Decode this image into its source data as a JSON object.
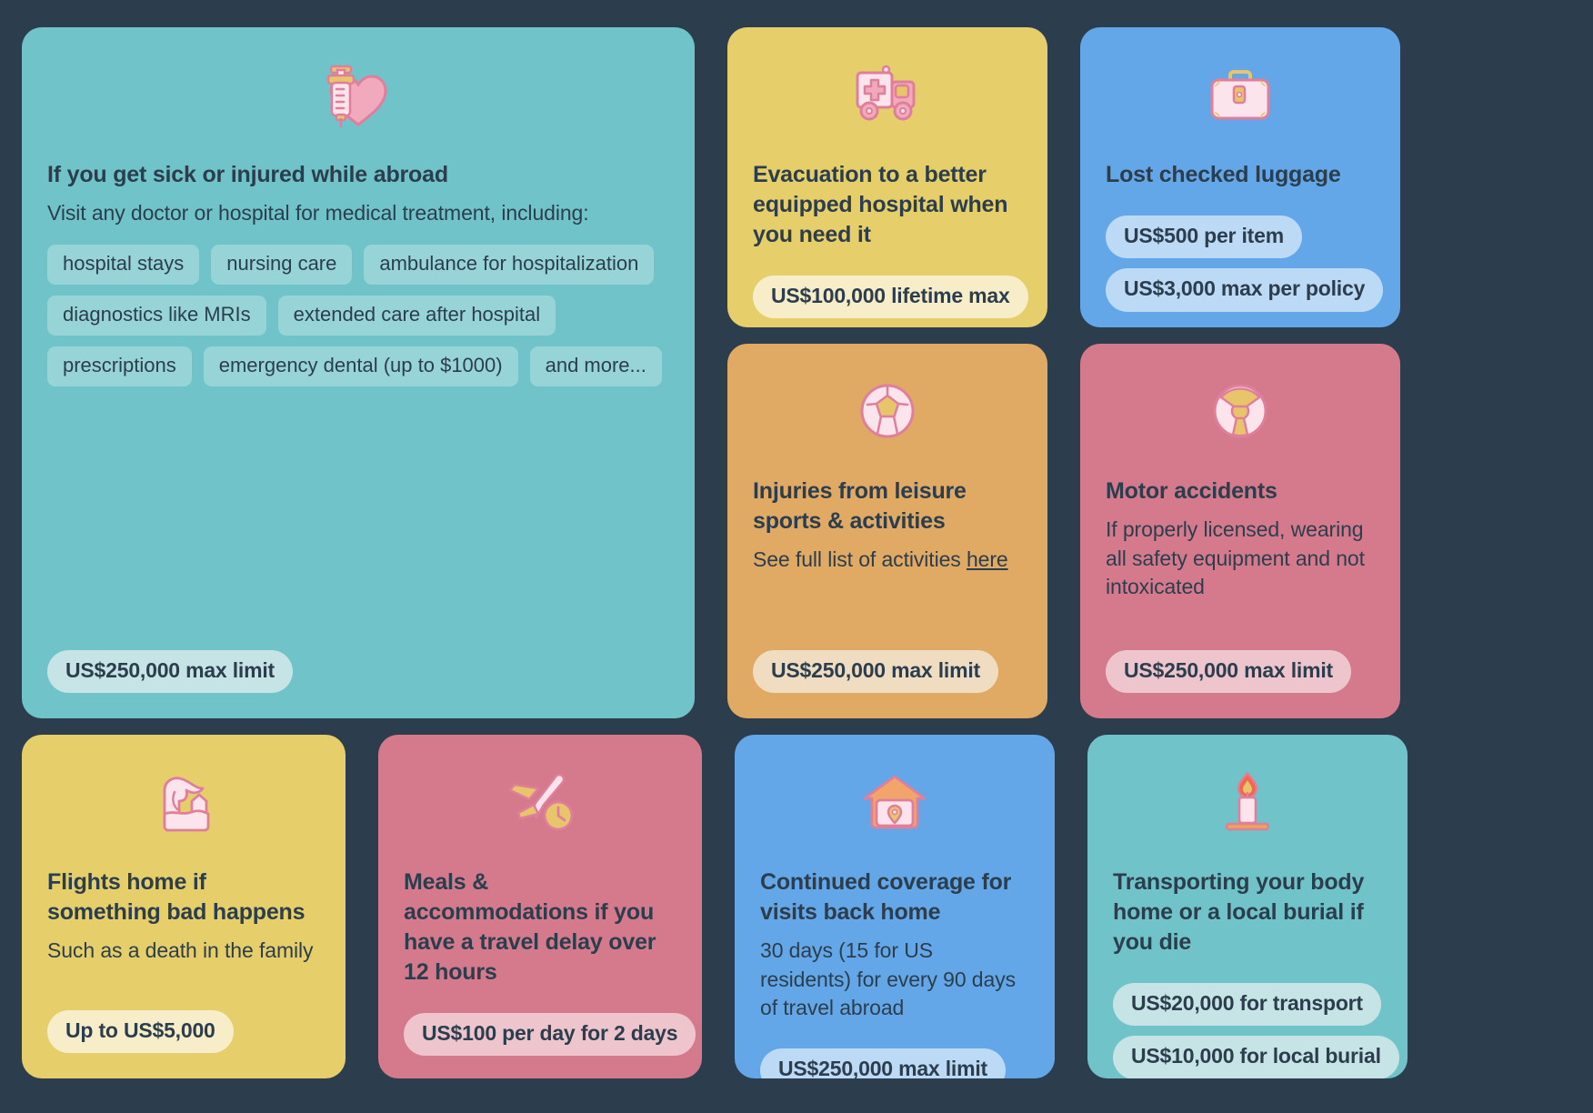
{
  "theme": {
    "background": "#2c3e4d",
    "text": "#2c3e4d",
    "teal": "#70c4c9",
    "yellow": "#e6cf6a",
    "blue": "#63a7e8",
    "orange": "#e0a964",
    "pink": "#d47a8c"
  },
  "cards": {
    "medical": {
      "icon": "syringe-heart-icon",
      "title": "If you get sick or injured while abroad",
      "subtitle": "Visit any doctor or hospital for medical treatment, including:",
      "pills": [
        "hospital stays",
        "nursing care",
        "ambulance for hospitalization",
        "diagnostics like MRIs",
        "extended care after hospital",
        "prescriptions",
        "emergency dental (up to $1000)",
        "and more..."
      ],
      "badges": [
        "US$250,000 max limit"
      ]
    },
    "evacuation": {
      "icon": "ambulance-icon",
      "title": "Evacuation to a better equipped hospital when you need it",
      "badges": [
        "US$100,000 lifetime max"
      ]
    },
    "luggage": {
      "icon": "suitcase-icon",
      "title": "Lost checked luggage",
      "badges": [
        "US$500 per item",
        "US$3,000 max per policy"
      ]
    },
    "sports": {
      "icon": "soccer-ball-icon",
      "title": "Injuries from leisure sports & activities",
      "subtitle_prefix": "See full list of activities ",
      "subtitle_link": "here",
      "badges": [
        "US$250,000 max limit"
      ]
    },
    "motor": {
      "icon": "steering-wheel-icon",
      "title": "Motor accidents",
      "subtitle": "If properly licensed, wearing all safety equipment and not intoxicated",
      "badges": [
        "US$250,000 max limit"
      ]
    },
    "flights": {
      "icon": "wave-house-icon",
      "title": "Flights home if something bad happens",
      "subtitle": "Such as a death in the family",
      "badges": [
        "Up to US$5,000"
      ]
    },
    "delay": {
      "icon": "plane-clock-icon",
      "title": "Meals & accommodations if you have a travel delay over 12 hours",
      "badges": [
        "US$100 per day for 2 days"
      ]
    },
    "home_visits": {
      "icon": "house-pin-icon",
      "title": "Continued coverage for visits back home",
      "subtitle": "30 days (15 for US residents) for every 90 days of travel abroad",
      "badges": [
        "US$250,000 max limit"
      ]
    },
    "repatriation": {
      "icon": "candle-icon",
      "title": "Transporting your body home or a local burial if you die",
      "badges": [
        "US$20,000 for transport",
        "US$10,000 for local burial"
      ]
    }
  }
}
